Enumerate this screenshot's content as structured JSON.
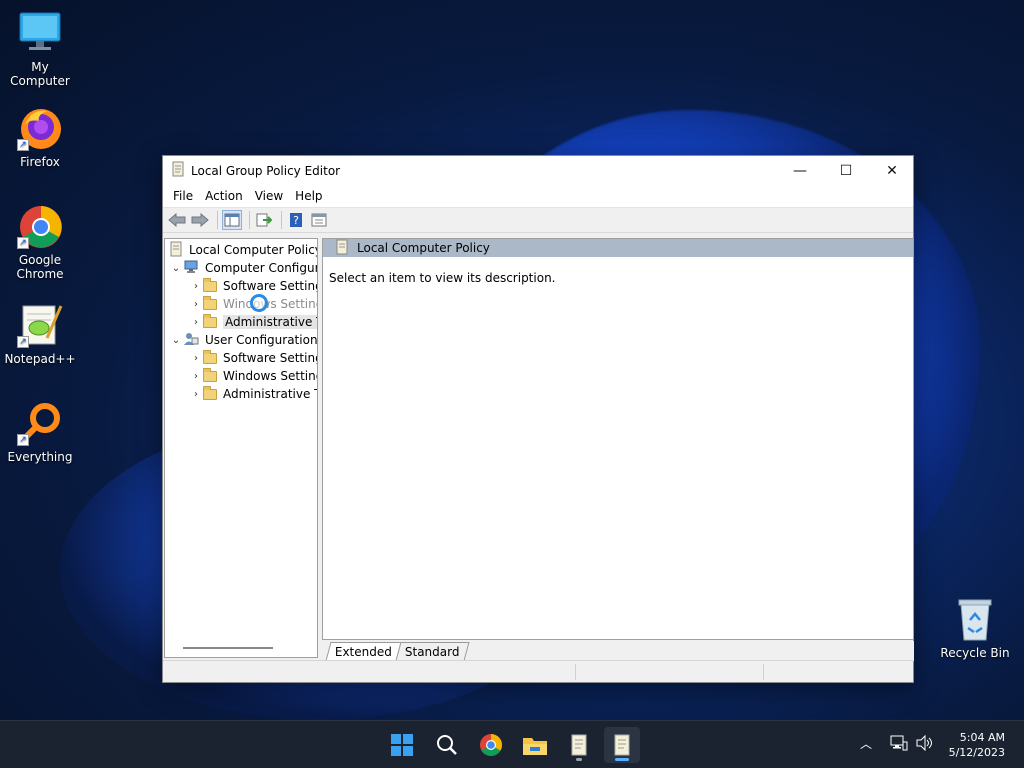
{
  "desktop": {
    "icons": [
      {
        "label": "My Computer",
        "icon": "monitor-icon"
      },
      {
        "label": "Firefox",
        "icon": "firefox-icon"
      },
      {
        "label": "Google Chrome",
        "icon": "chrome-icon"
      },
      {
        "label": "Notepad++",
        "icon": "notepadpp-icon"
      },
      {
        "label": "Everything",
        "icon": "search-magnifier-icon"
      },
      {
        "label": "Recycle Bin",
        "icon": "recycle-bin-icon"
      }
    ]
  },
  "window": {
    "title": "Local Group Policy Editor",
    "controls": {
      "minimize": "—",
      "maximize": "☐",
      "close": "✕"
    },
    "menu": [
      "File",
      "Action",
      "View",
      "Help"
    ],
    "toolbar": [
      "back-icon",
      "forward-icon",
      "show-hide-tree-icon",
      "export-list-icon",
      "help-icon",
      "properties-icon"
    ],
    "tree": {
      "root": "Local Computer Policy",
      "computer_config": "Computer Configura",
      "computer_children": [
        "Software Settings",
        "Windows Settings",
        "Administrative Te"
      ],
      "user_config": "User Configuration",
      "user_children": [
        "Software Settings",
        "Windows Setting",
        "Administrative Te"
      ]
    },
    "right_pane": {
      "header": "Local Computer Policy",
      "description": "Select an item to view its description."
    },
    "tabs": [
      "Extended",
      "Standard"
    ],
    "active_tab": "Extended"
  },
  "taskbar": {
    "apps": [
      "start-icon",
      "search-icon",
      "chrome-icon",
      "file-explorer-icon",
      "notepad-scroll-icon",
      "group-policy-icon"
    ],
    "clock": {
      "time": "5:04 AM",
      "date": "5/12/2023"
    }
  },
  "colors": {
    "accent": "#2a8ae6",
    "header_band": "#aab8c8",
    "taskbar": "#1b2330"
  }
}
